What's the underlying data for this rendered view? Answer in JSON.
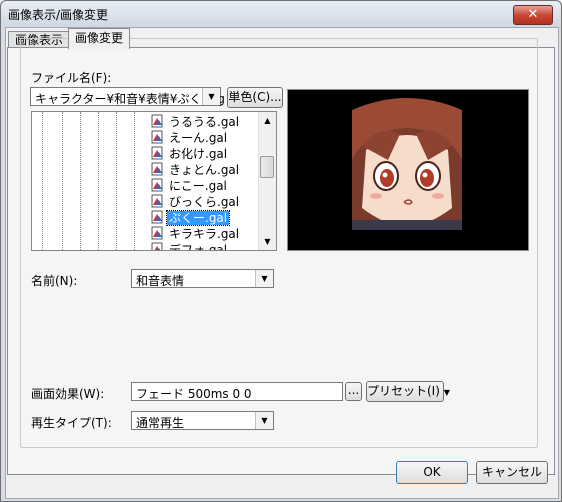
{
  "window": {
    "title": "画像表示/画像変更",
    "close_label": "✕"
  },
  "tabs": [
    {
      "label": "画像表示"
    },
    {
      "label": "画像変更"
    }
  ],
  "file": {
    "label": "ファイル名(F):",
    "path_value": "キャラクター¥和音¥表情¥ぷくー.g",
    "mono_button": "単色(C)..."
  },
  "file_list": [
    {
      "name": "うるうる.gal"
    },
    {
      "name": "えーん.gal"
    },
    {
      "name": "お化け.gal"
    },
    {
      "name": "きょとん.gal"
    },
    {
      "name": "にこー.gal"
    },
    {
      "name": "びっくら.gal"
    },
    {
      "name": "ぷくー.gal",
      "selected": true
    },
    {
      "name": "キラキラ.gal"
    },
    {
      "name": "デフォ.gal"
    }
  ],
  "name_field": {
    "label": "名前(N):",
    "value": "和音表情"
  },
  "effect": {
    "label": "画面効果(W):",
    "value": "フェード 500ms 0 0",
    "browse_label": "...",
    "preset_label": "プリセット(I)"
  },
  "playback": {
    "label": "再生タイプ(T):",
    "value": "通常再生"
  },
  "buttons": {
    "ok": "OK",
    "cancel": "キャンセル"
  },
  "colors": {
    "selection": "#3399ff",
    "preview_bg": "#000000",
    "close_button": "#c74a38"
  }
}
